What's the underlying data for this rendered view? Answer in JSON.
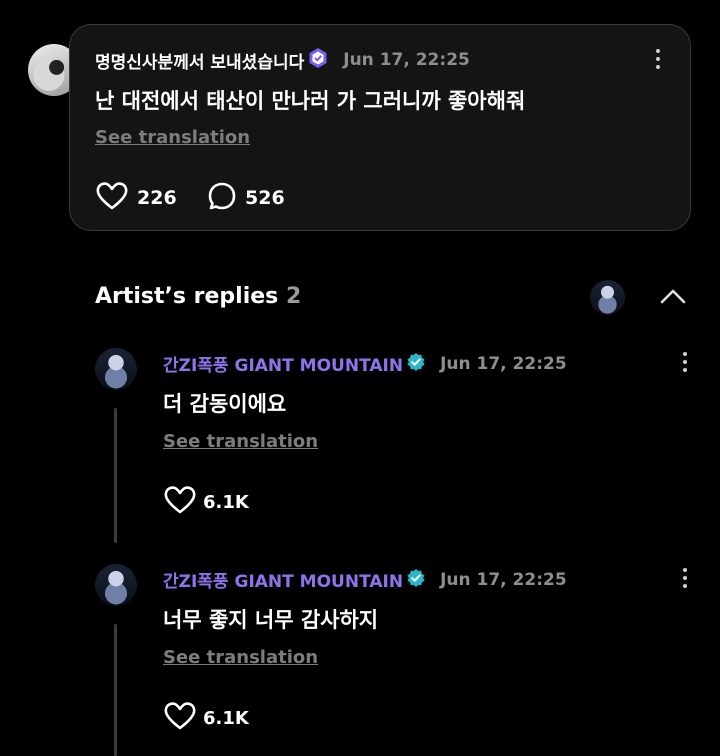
{
  "post": {
    "author": "명명신사분께서 보내셨습니다",
    "timestamp": "Jun 17, 22:25",
    "text": "난 대전에서 태산이 만나러 가 그러니까 좋아해줘",
    "see_translation": "See translation",
    "likes": "226",
    "comments": "526",
    "verified_badge_color": "#7b5cf0"
  },
  "replies_section": {
    "title": "Artist’s replies",
    "count": "2"
  },
  "replies": [
    {
      "author": "간ZI폭풍 GIANT MOUNTAIN",
      "timestamp": "Jun 17, 22:25",
      "text": "더 감동이에요",
      "see_translation": "See translation",
      "likes": "6.1K"
    },
    {
      "author": "간ZI폭풍 GIANT MOUNTAIN",
      "timestamp": "Jun 17, 22:25",
      "text": "너무 좋지 너무 감사하지",
      "see_translation": "See translation",
      "likes": "6.1K"
    }
  ],
  "colors": {
    "artist_name": "#8f73ea",
    "verified_check": "#2bb5c9"
  }
}
